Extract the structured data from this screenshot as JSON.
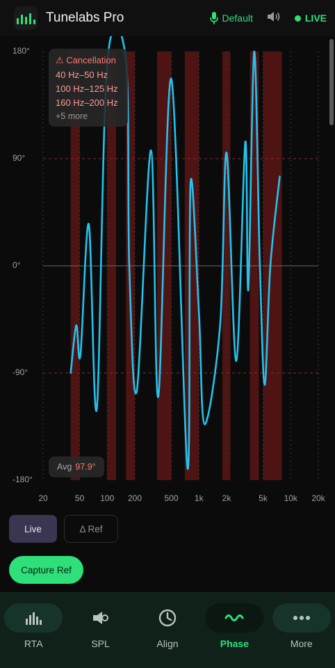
{
  "app": {
    "title": "Tunelabs Pro"
  },
  "header": {
    "input_label": "Default",
    "status_label": "LIVE",
    "mic_icon": "mic-icon",
    "speaker_icon": "speaker-icon"
  },
  "cancellation": {
    "title": "⚠ Cancellation",
    "ranges": [
      "40 Hz–50 Hz",
      "100 Hz–125 Hz",
      "160 Hz–200 Hz"
    ],
    "more": "+5 more"
  },
  "average": {
    "label": "Avg",
    "value": "97.9°"
  },
  "controls": {
    "live": "Live",
    "delta_ref": "Δ Ref",
    "capture": "Capture Ref"
  },
  "nav": {
    "items": [
      {
        "label": "RTA",
        "icon": "bars-icon"
      },
      {
        "label": "SPL",
        "icon": "speaker-icon"
      },
      {
        "label": "Align",
        "icon": "clock-icon"
      },
      {
        "label": "Phase",
        "icon": "wave-icon"
      },
      {
        "label": "More",
        "icon": "dots-icon"
      }
    ],
    "active": "Phase"
  },
  "colors": {
    "accent": "#2fe07a",
    "trace": "#22c3ee",
    "cancel_band": "#5a1616",
    "warn": "#ff7b72"
  },
  "chart_data": {
    "type": "line",
    "x_scale": "log",
    "x_range": [
      20,
      20000
    ],
    "y_range": [
      -180,
      180
    ],
    "y_ticks": [
      180,
      90,
      0,
      -90,
      -180
    ],
    "y_tick_labels": [
      "180°",
      "90°",
      "0°",
      "-90°",
      "-180°"
    ],
    "x_ticks": [
      20,
      50,
      100,
      200,
      500,
      1000,
      2000,
      5000,
      10000,
      20000
    ],
    "x_tick_labels": [
      "20",
      "50",
      "100",
      "200",
      "500",
      "1k",
      "2k",
      "5k",
      "10k",
      "20k"
    ],
    "cancel_bands_hz": [
      [
        40,
        50
      ],
      [
        100,
        125
      ],
      [
        160,
        200
      ],
      [
        350,
        500
      ],
      [
        700,
        1000
      ],
      [
        1800,
        2200
      ],
      [
        3600,
        4500
      ],
      [
        5000,
        8000
      ]
    ],
    "series": [
      {
        "x": [
          40,
          46,
          51,
          63,
          77,
          100,
          160,
          174,
          210,
          300,
          360,
          500,
          750,
          810,
          1000,
          1150,
          1700,
          2000,
          2550,
          3200,
          3450,
          4000,
          4600,
          5200,
          6000,
          7600
        ],
        "y": [
          -90,
          -50,
          -75,
          35,
          -120,
          170,
          173,
          0,
          -105,
          97,
          -110,
          157,
          -170,
          70,
          -40,
          -133,
          -50,
          95,
          -80,
          104,
          -20,
          180,
          5,
          -100,
          0,
          75
        ]
      }
    ]
  }
}
